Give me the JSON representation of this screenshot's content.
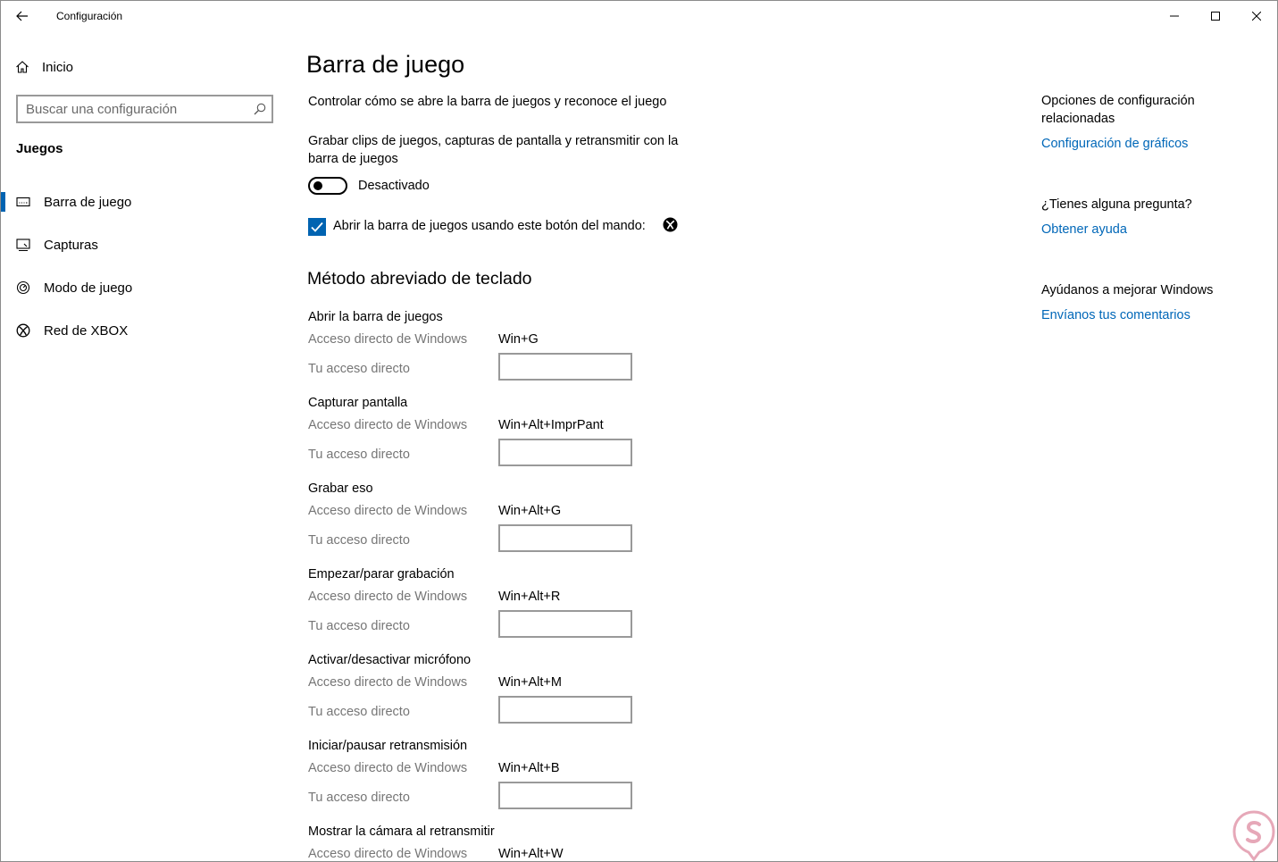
{
  "window": {
    "title": "Configuración"
  },
  "sidebar": {
    "home_label": "Inicio",
    "search_placeholder": "Buscar una configuración",
    "section_title": "Juegos",
    "items": [
      {
        "label": "Barra de juego",
        "icon": "game-bar-icon"
      },
      {
        "label": "Capturas",
        "icon": "captures-icon"
      },
      {
        "label": "Modo de juego",
        "icon": "game-mode-icon"
      },
      {
        "label": "Red de XBOX",
        "icon": "xbox-icon"
      }
    ]
  },
  "main": {
    "title": "Barra de juego",
    "description": "Controlar cómo se abre la barra de juegos y reconoce el juego",
    "record_label_line1": "Grabar clips de juegos, capturas de pantalla y retransmitir con la",
    "record_label_line2": "barra de juegos",
    "toggle_state": "Desactivado",
    "checkbox_label": "Abrir la barra de juegos usando este botón del mando:",
    "checkbox_checked": true,
    "shortcuts_heading": "Método abreviado de teclado",
    "windows_shortcut_label": "Acceso directo de Windows",
    "your_shortcut_label": "Tu acceso directo",
    "shortcuts": [
      {
        "name": "Abrir la barra de juegos",
        "windows": "Win+G"
      },
      {
        "name": "Capturar pantalla",
        "windows": "Win+Alt+ImprPant"
      },
      {
        "name": "Grabar eso",
        "windows": "Win+Alt+G"
      },
      {
        "name": "Empezar/parar grabación",
        "windows": "Win+Alt+R"
      },
      {
        "name": "Activar/desactivar micrófono",
        "windows": "Win+Alt+M"
      },
      {
        "name": "Iniciar/pausar retransmisión",
        "windows": "Win+Alt+B"
      },
      {
        "name": "Mostrar la cámara al retransmitir",
        "windows": "Win+Alt+W"
      }
    ]
  },
  "related": {
    "heading_line1": "Opciones de configuración",
    "heading_line2": "relacionadas",
    "graphics_link": "Configuración de gráficos",
    "question": "¿Tienes alguna pregunta?",
    "help_link": "Obtener ayuda",
    "improve": "Ayúdanos a mejorar Windows",
    "feedback_link": "Envíanos tus comentarios"
  },
  "colors": {
    "accent": "#0063b1",
    "link": "#0067b8",
    "muted": "#767676"
  }
}
